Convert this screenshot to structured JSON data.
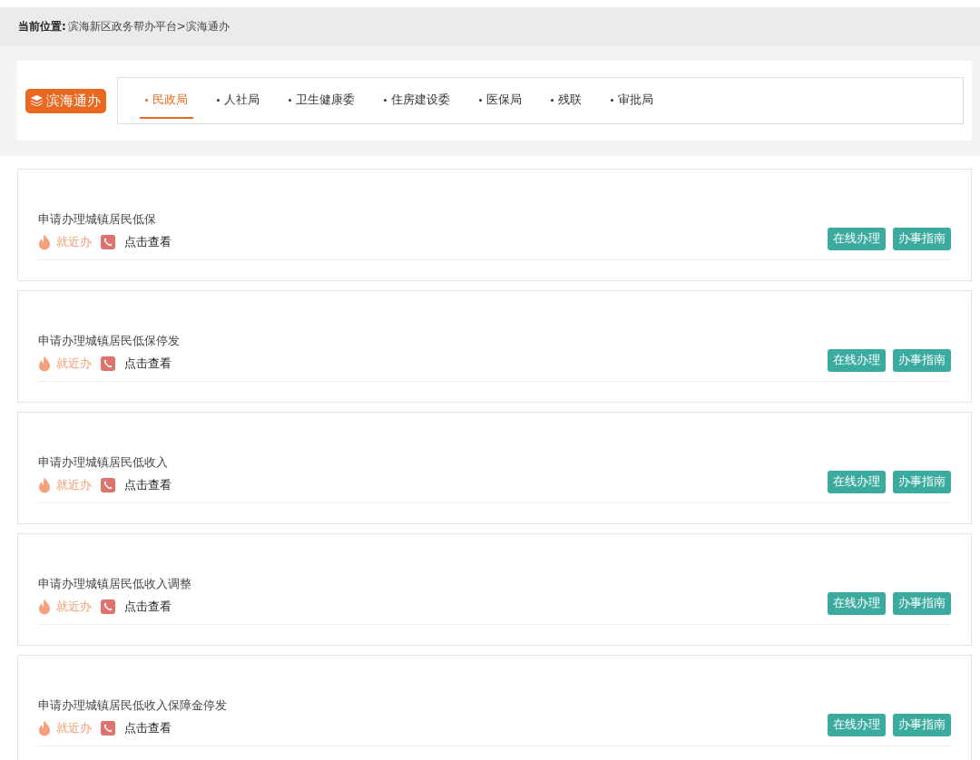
{
  "breadcrumb": {
    "label": "当前位置:",
    "path": "滨海新区政务帮办平台>滨海通办"
  },
  "brand": {
    "title": "滨海通办"
  },
  "tabs": [
    {
      "label": "民政局",
      "selected": true
    },
    {
      "label": "人社局",
      "selected": false
    },
    {
      "label": "卫生健康委",
      "selected": false
    },
    {
      "label": "住房建设委",
      "selected": false
    },
    {
      "label": "医保局",
      "selected": false
    },
    {
      "label": "残联",
      "selected": false
    },
    {
      "label": "审批局",
      "selected": false
    }
  ],
  "services": [
    {
      "title": "申请办理城镇居民低保",
      "nearby": "就近办",
      "contact": "点击查看",
      "buttons": [
        "在线办理",
        "办事指南"
      ]
    },
    {
      "title": "申请办理城镇居民低保停发",
      "nearby": "就近办",
      "contact": "点击查看",
      "buttons": [
        "在线办理",
        "办事指南"
      ]
    },
    {
      "title": "申请办理城镇居民低收入",
      "nearby": "就近办",
      "contact": "点击查看",
      "buttons": [
        "在线办理",
        "办事指南"
      ]
    },
    {
      "title": "申请办理城镇居民低收入调整",
      "nearby": "就近办",
      "contact": "点击查看",
      "buttons": [
        "在线办理",
        "办事指南"
      ]
    },
    {
      "title": "申请办理城镇居民低收入保障金停发",
      "nearby": "就近办",
      "contact": "点击查看",
      "buttons": [
        "在线办理",
        "办事指南"
      ]
    }
  ]
}
